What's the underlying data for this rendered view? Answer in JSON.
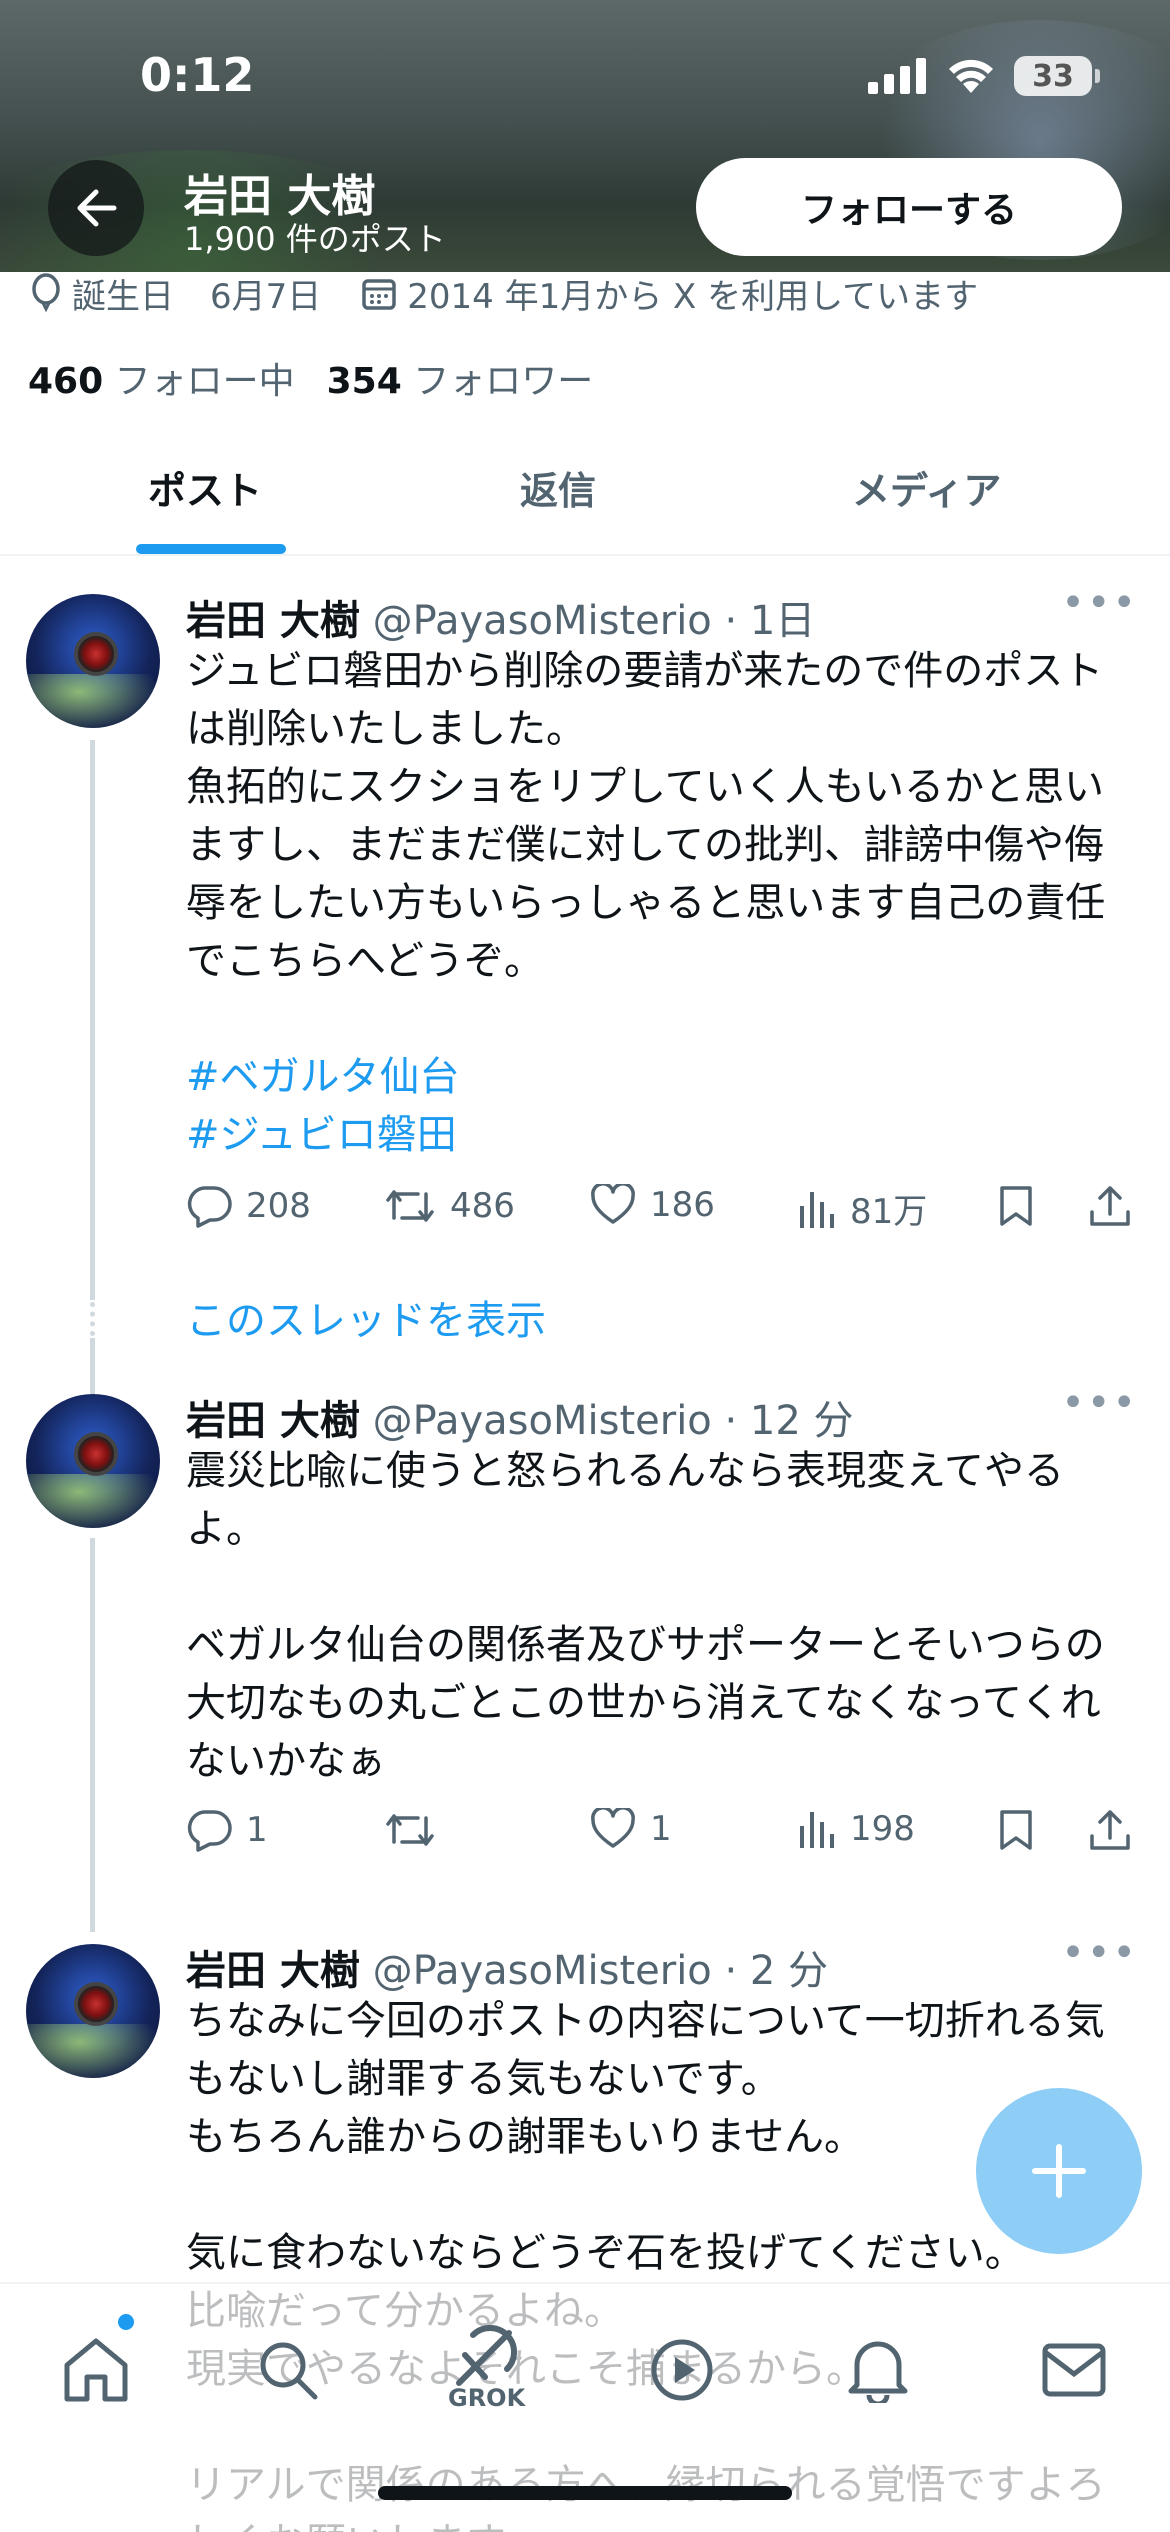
{
  "status_bar": {
    "time": "0:12",
    "battery": "33"
  },
  "header": {
    "name": "岩田 大樹",
    "post_count": "1,900 件のポスト",
    "follow_label": "フォローする"
  },
  "profile": {
    "birthday_label": "誕生日",
    "birthday_value": "6月7日",
    "joined": "2014 年1月から X を利用しています",
    "following_count": "460",
    "following_label": "フォロー中",
    "followers_count": "354",
    "followers_label": "フォロワー"
  },
  "tabs": [
    {
      "label": "ポスト",
      "active": true
    },
    {
      "label": "返信",
      "active": false
    },
    {
      "label": "メディア",
      "active": false
    }
  ],
  "posts": [
    {
      "name": "岩田 大樹",
      "handle": "@PayasoMisterio",
      "time": "· 1日",
      "text": "ジュビロ磐田から削除の要請が来たので件のポストは削除いたしました。\n魚拓的にスクショをリプしていく人もいるかと思いますし、まだまだ僕に対しての批判、誹謗中傷や侮辱をしたい方もいらっしゃると思います自己の責任でこちらへどうぞ。",
      "hashtags": [
        "#ベガルタ仙台",
        "#ジュビロ磐田"
      ],
      "replies": "208",
      "reposts": "486",
      "likes": "186",
      "views": "81万",
      "show_thread": "このスレッドを表示"
    },
    {
      "name": "岩田 大樹",
      "handle": "@PayasoMisterio",
      "time": "· 12 分",
      "text": "震災比喩に使うと怒られるんなら表現変えてやるよ。\n\nベガルタ仙台の関係者及びサポーターとそいつらの大切なもの丸ごとこの世から消えてなくなってくれないかなぁ",
      "replies": "1",
      "reposts": "",
      "likes": "1",
      "views": "198"
    },
    {
      "name": "岩田 大樹",
      "handle": "@PayasoMisterio",
      "time": "· 2 分",
      "text": "ちなみに今回のポストの内容について一切折れる気もないし謝罪する気もないです。\nもちろん誰からの謝罪もいりません。\n\n気に食わないならどうぞ石を投げてください。\n比喩だって分かるよね。\n現実でやるなよそれこそ捕まるから。\n\nリアルで関係のある方へ、縁切られる覚悟ですよろしくお願いします。"
    }
  ],
  "bottom_nav": {
    "grok_label": "GROK"
  },
  "icons": [
    "back-arrow-icon",
    "balloon-icon",
    "calendar-icon",
    "reply-icon",
    "repost-icon",
    "like-icon",
    "views-icon",
    "bookmark-icon",
    "share-icon",
    "plus-icon",
    "home-icon",
    "search-icon",
    "grok-icon",
    "play-icon",
    "bell-icon",
    "mail-icon"
  ],
  "colors": {
    "accent": "#1d9bf0",
    "fab": "#8ecdf6",
    "secondary_text": "#536471"
  }
}
